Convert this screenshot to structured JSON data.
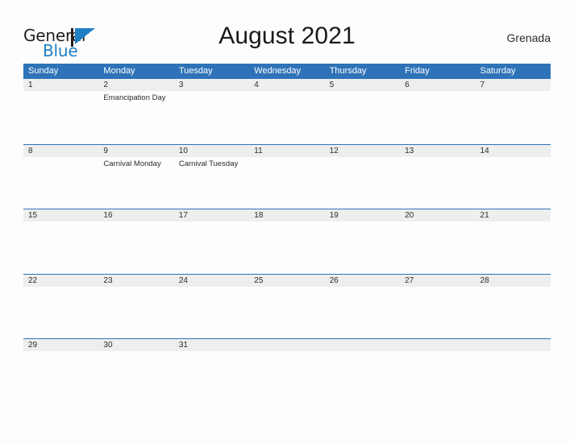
{
  "brand": {
    "name_top": "General",
    "name_bottom": "Blue",
    "flag_icon": "flag-icon",
    "accent_color": "#1f7fc4"
  },
  "header": {
    "title": "August 2021",
    "country": "Grenada"
  },
  "theme": {
    "header_blue": "#2e73b8",
    "date_strip_gray": "#eeeeee",
    "page_background": "#fdfdfd",
    "text_color": "#2b2b2b"
  },
  "calendar": {
    "weekdays": [
      "Sunday",
      "Monday",
      "Tuesday",
      "Wednesday",
      "Thursday",
      "Friday",
      "Saturday"
    ],
    "weeks": [
      {
        "days": [
          {
            "num": "1",
            "events": []
          },
          {
            "num": "2",
            "events": [
              "Emancipation Day"
            ]
          },
          {
            "num": "3",
            "events": []
          },
          {
            "num": "4",
            "events": []
          },
          {
            "num": "5",
            "events": []
          },
          {
            "num": "6",
            "events": []
          },
          {
            "num": "7",
            "events": []
          }
        ]
      },
      {
        "days": [
          {
            "num": "8",
            "events": []
          },
          {
            "num": "9",
            "events": [
              "Carnival Monday"
            ]
          },
          {
            "num": "10",
            "events": [
              "Carnival Tuesday"
            ]
          },
          {
            "num": "11",
            "events": []
          },
          {
            "num": "12",
            "events": []
          },
          {
            "num": "13",
            "events": []
          },
          {
            "num": "14",
            "events": []
          }
        ]
      },
      {
        "days": [
          {
            "num": "15",
            "events": []
          },
          {
            "num": "16",
            "events": []
          },
          {
            "num": "17",
            "events": []
          },
          {
            "num": "18",
            "events": []
          },
          {
            "num": "19",
            "events": []
          },
          {
            "num": "20",
            "events": []
          },
          {
            "num": "21",
            "events": []
          }
        ]
      },
      {
        "days": [
          {
            "num": "22",
            "events": []
          },
          {
            "num": "23",
            "events": []
          },
          {
            "num": "24",
            "events": []
          },
          {
            "num": "25",
            "events": []
          },
          {
            "num": "26",
            "events": []
          },
          {
            "num": "27",
            "events": []
          },
          {
            "num": "28",
            "events": []
          }
        ]
      },
      {
        "days": [
          {
            "num": "29",
            "events": []
          },
          {
            "num": "30",
            "events": []
          },
          {
            "num": "31",
            "events": []
          },
          {
            "num": "",
            "events": []
          },
          {
            "num": "",
            "events": []
          },
          {
            "num": "",
            "events": []
          },
          {
            "num": "",
            "events": []
          }
        ]
      }
    ]
  }
}
